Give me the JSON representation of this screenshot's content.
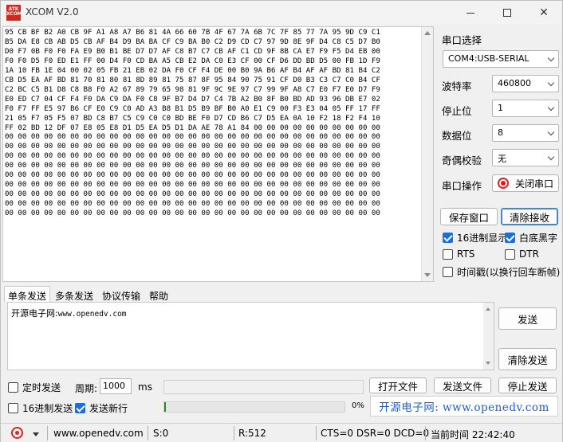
{
  "window": {
    "title": "XCOM V2.0",
    "logo_text": "ATK XCOM"
  },
  "receive": {
    "lines": [
      "95 CB BF B2 A0 CB 9F A1 A8 A7 B6 81 4A 66 60 7B 4F 67 7A 6B 7C 7F 85 77 7A 95 9D C9 C1",
      "B5 DA E8 CB AB D5 CB AF B4 D9 BA BA CF C9 BA B0 C2 D9 CD C7 97 9D 8E 9F D4 C8 C5 D7 B0",
      "D0 F7 0B F0 F0 FA E9 B0 B1 BE D7 D7 AF C8 B7 C7 CB AF C1 CD 9F 8B CA E7 F9 F5 D4 EB 00",
      "F0 F0 D5 F0 ED E1 FF 00 D4 F0 CD BA A5 CB E2 DA C0 E3 CF 00 CF D6 DD BD D5 00 FB 1D F9",
      "1A 10 FB 1E 04 00 02 05 FB 21 EB 02 DA F0 CF F4 DE 00 B0 9A B6 AF B4 AF AF BD 81 B4 C2",
      "CB D5 EA AF BD 81 70 81 80 81 8D 89 81 75 87 8F 95 84 90 75 91 CF D0 B3 C3 C7 C0 B4 CF",
      "C2 BC C5 B1 D8 C8 B8 F0 A2 67 89 79 65 98 81 9F 9C 9E 97 C7 99 9F A8 C7 E0 F7 E0 D7 F9",
      "E0 ED C7 04 CF F4 F0 DA C9 DA F0 C8 9F B7 D4 D7 C4 7B A2 B0 8F B0 BD AD 93 96 DB E7 02",
      "F0 F7 FF E5 97 B6 CF E0 C9 C0 AD A3 B8 B1 D5 B9 BF B0 A0 E1 C9 00 F3 E3 04 05 FF 17 FF",
      "21 05 F7 05 F5 07 BD C8 B7 C5 C9 C0 C0 BD BE F0 D7 CD B6 C7 D5 EA 0A 10 F2 18 F2 F4 10",
      "FF 02 BD 12 DF 07 E8 05 E8 D1 D5 EA D5 D1 DA AE 78 A1 84 00 00 00 00 00 00 00 00 00 00",
      "00 00 00 00 00 00 00 00 00 00 00 00 00 00 00 00 00 00 00 00 00 00 00 00 00 00 00 00 00",
      "00 00 00 00 00 00 00 00 00 00 00 00 00 00 00 00 00 00 00 00 00 00 00 00 00 00 00 00 00",
      "00 00 00 00 00 00 00 00 00 00 00 00 00 00 00 00 00 00 00 00 00 00 00 00 00 00 00 00 00",
      "00 00 00 00 00 00 00 00 00 00 00 00 00 00 00 00 00 00 00 00 00 00 00 00 00 00 00 00 00",
      "00 00 00 00 00 00 00 00 00 00 00 00 00 00 00 00 00 00 00 00 00 00 00 00 00 00 00 00 00",
      "00 00 00 00 00 00 00 00 00 00 00 00 00 00 00 00 00 00 00 00 00 00 00 00 00 00 00 00 00",
      "00 00 00 00 00 00 00 00 00 00 00 00 00 00 00 00 00 00 00 00 00 00 00 00 00 00 00 00 00",
      "00 00 00 00 00 00 00 00 00 00 00 00 00 00 00 00 00 00 00 00 00 00 00 00 00 00 00 00 00",
      "00 00 00 00 00 00 00 00 00 00 00 00 00 00 00 00 00 00 00 00 00 00 00 00 00 00 00 00 00"
    ]
  },
  "settings": {
    "port_label": "串口选择",
    "port_value": "COM4:USB-SERIAL",
    "baud_label": "波特率",
    "baud_value": "460800",
    "stop_label": "停止位",
    "stop_value": "1",
    "data_label": "数据位",
    "data_value": "8",
    "parity_label": "奇偶校验",
    "parity_value": "无",
    "op_label": "串口操作",
    "close_port": "关闭串口"
  },
  "actions": {
    "save_window": "保存窗口",
    "clear_recv": "清除接收",
    "hex_display": "16进制显示",
    "white_bg": "白底黑字",
    "rts": "RTS",
    "dtr": "DTR",
    "timestamp": "时间戳(以换行回车断帧)"
  },
  "tabs": [
    "单条发送",
    "多条发送",
    "协议传输",
    "帮助"
  ],
  "send": {
    "label": "开源电子网:",
    "url": "www.openedv.com",
    "send_button": "发送",
    "clear_send": "清除发送",
    "timed_send": "定时发送",
    "period_label": "周期:",
    "period_value": "1000",
    "period_unit": "ms",
    "hex_send": "16进制发送",
    "send_newline": "发送新行",
    "open_file": "打开文件",
    "send_file": "发送文件",
    "stop_send": "停止发送",
    "progress_pct": "0%",
    "progress_fraction": 0.01,
    "link_text": "开源电子网: www.openedv.com"
  },
  "status": {
    "website": "www.openedv.com",
    "sent": "S:0",
    "received": "R:512",
    "lines": "CTS=0 DSR=0 DCD=0",
    "time": "当前时间 22:42:40"
  },
  "colors": {
    "accent": "#1d6ed8",
    "link": "#2060c8",
    "logo": "#d8261c"
  }
}
